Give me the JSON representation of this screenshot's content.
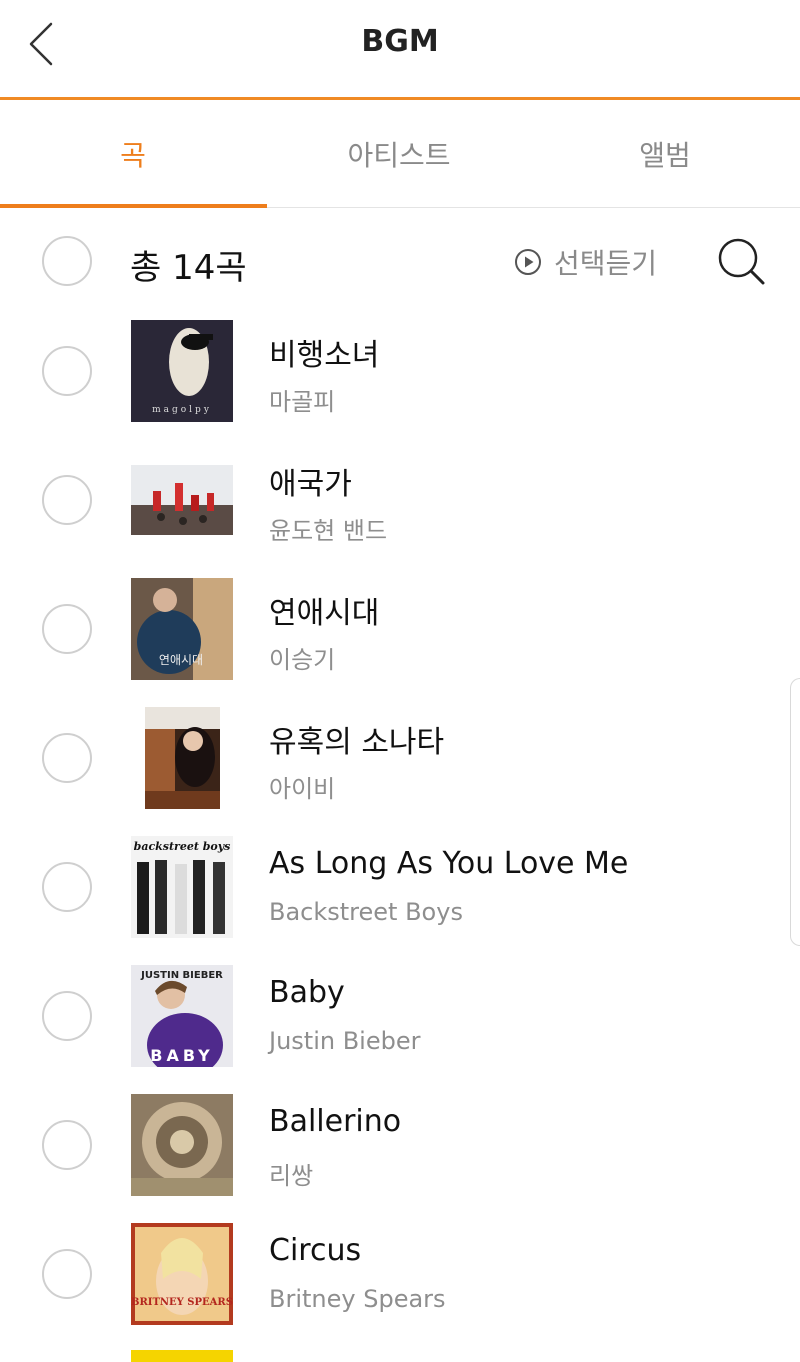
{
  "header": {
    "title": "BGM",
    "back_icon": "chevron-left-icon"
  },
  "tabs": [
    {
      "label": "곡",
      "active": true
    },
    {
      "label": "아티스트",
      "active": false
    },
    {
      "label": "앨범",
      "active": false
    }
  ],
  "toolbar": {
    "total": "총 14곡",
    "play_selected": "선택듣기",
    "play_icon": "play-circle-icon",
    "search_icon": "search-icon"
  },
  "songs": [
    {
      "title": "비행소녀",
      "artist": "마골피",
      "cover_text": "magolpy"
    },
    {
      "title": "애국가",
      "artist": "윤도현 밴드",
      "cover_text": ""
    },
    {
      "title": "연애시대",
      "artist": "이승기",
      "cover_text": "연애시대"
    },
    {
      "title": "유혹의 소나타",
      "artist": "아이비",
      "cover_text": ""
    },
    {
      "title": "As Long As You Love Me",
      "artist": "Backstreet Boys",
      "cover_text": "backstreet boys"
    },
    {
      "title": "Baby",
      "artist": "Justin Bieber",
      "cover_text": "JUSTIN BIEBER BABY"
    },
    {
      "title": "Ballerino",
      "artist": "리쌍",
      "cover_text": ""
    },
    {
      "title": "Circus",
      "artist": "Britney Spears",
      "cover_text": "BRITNEY SPEARS"
    }
  ],
  "colors": {
    "accent": "#ee7e1c",
    "header_line": "#f08a24",
    "muted": "#8a8a8a"
  }
}
